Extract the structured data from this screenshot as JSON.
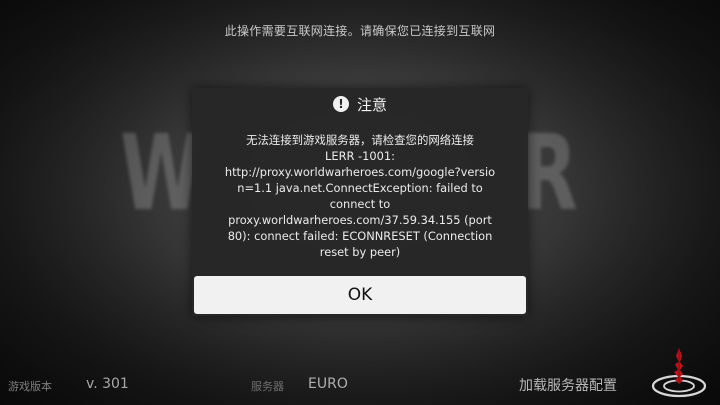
{
  "background": {
    "logo_left": "W",
    "logo_right": "R"
  },
  "top_notice": "此操作需要互联网连接。请确保您已连接到互联网",
  "dialog": {
    "title": "注意",
    "icon": "alert-circle-icon",
    "message_lines": [
      "无法连接到游戏服务器，请检查您的网络连接",
      "LERR -1001:",
      "http://proxy.worldwarheroes.com/google?versio",
      "n=1.1 java.net.ConnectException: failed to",
      "connect to",
      "proxy.worldwarheroes.com/37.59.34.155 (port",
      "80): connect failed: ECONNRESET (Connection",
      "reset by peer)"
    ],
    "ok_label": "OK"
  },
  "bottom_bar": {
    "version_label": "游戏版本",
    "version_value": "v. 301",
    "server_label": "服务器",
    "server_value": "EURO",
    "load_config_label": "加载服务器配置"
  },
  "colors": {
    "dialog_bg": "#262626",
    "button_bg": "#f1f1f1",
    "accent_red": "#c0121a"
  }
}
